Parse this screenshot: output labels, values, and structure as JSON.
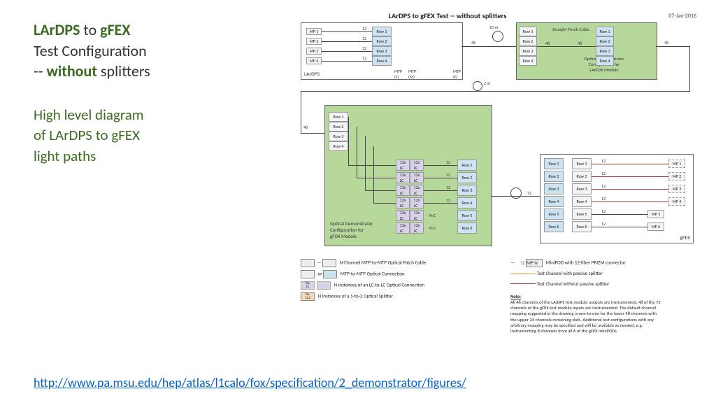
{
  "title": {
    "w1": "LArDPS",
    "w2": " to ",
    "w3": "gFEX",
    "line2a": "Test Configuration",
    "line3a": "-- ",
    "line3b": "without",
    "line3c": " splitters"
  },
  "subtitle": {
    "l1": "High level diagram",
    "l2": "of LArDPS to gFEX",
    "l3": "light paths"
  },
  "footer": {
    "url": "http://www.pa.msu.edu/hep/atlas/l1calo/fox/specification/2_demonstrator/figures/"
  },
  "diagram": {
    "title": "LArDPS to gFEX Test -- without splitters",
    "date": "07-Jan-2016",
    "row": [
      "Row 1",
      "Row 2",
      "Row 3",
      "Row 4",
      "Row 5",
      "Row 6"
    ],
    "mp": [
      "MP 1",
      "MP 2",
      "MP 3",
      "MP 4",
      "MP 5",
      "MP 6",
      "MP N"
    ],
    "mtpF": "MTP\n(F)",
    "mtpM": "MTP\n(M)",
    "fortyeight": "48",
    "seventytwo": "72",
    "tenm": "10 m",
    "twom": "2 m",
    "twelve": "12",
    "lardps": "LArDPS",
    "gfex": "gFEX",
    "trunk": "Straight Trunk Cable",
    "odLarfox": "Optical Demonstrator\nConfiguration for\nLArFOX Module",
    "odGfox": "Optical Demonstrator\nConfiguration for\ngFOX Module",
    "lcx": "12x\nLC",
    "nxLC": "Nx\nLC",
    "nx12": "Nx\n1x2",
    "nic": "N/C"
  },
  "legend": {
    "l1": "N-Channel MTP-to-MTP Optical Patch Cable",
    "l2": "MTP-to-MTP Optical Connection",
    "l3": "N instances of  an LC-to-LC Optical Connection",
    "l4": "N instances of  a 1-to-2 Optical Splitter",
    "r1": "MiniPOD with 12-fiber PRIZM connector",
    "r2": "Test Channel with passive splitter",
    "r3": "Test Channel without passive splitter"
  },
  "note": {
    "head": "Note:",
    "body": "All 48 channels of the LArDPS test module outputs are instrumented. 48 of the 72 channels of the gFEX test module inputs are instrumented. The default channel mapping suggested in the drawing is one-to-one for the lower 48 channels with the upper 24 channels remaining dark. Additional test configurations with any arbitrary mapping may be specified and will be available as needed, e.g. instrumenting 8 channels from all 6 of the gFEX miniPODs."
  }
}
